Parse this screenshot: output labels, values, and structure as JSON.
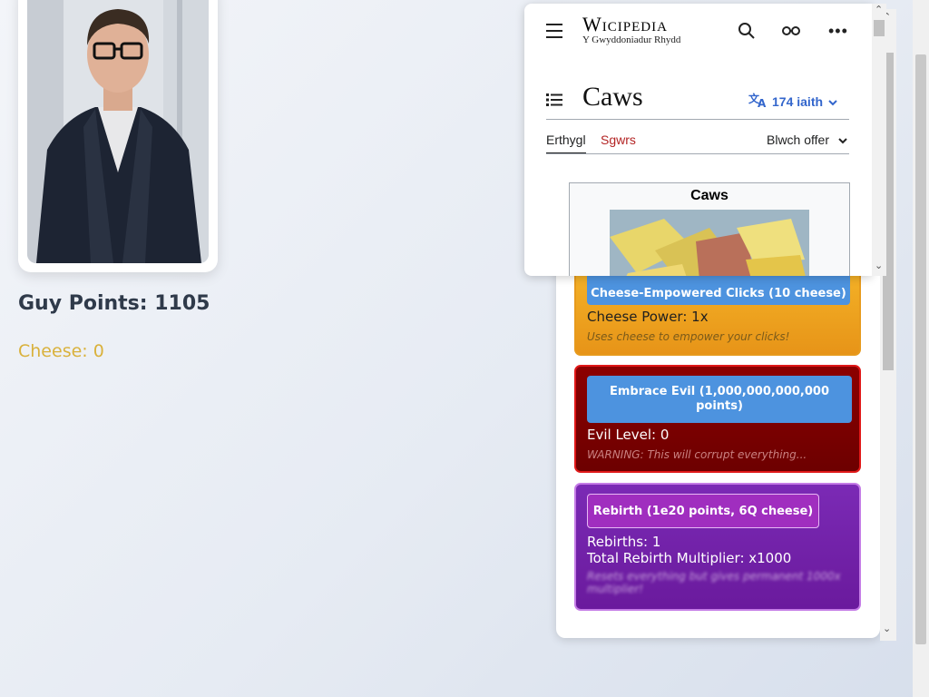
{
  "profile": {
    "photo_alt": "Profile photo of a man in glasses and dark jacket"
  },
  "stats": {
    "guy_points": "Guy Points: 1105",
    "cheese": "Cheese: 0"
  },
  "shop": {
    "cheese_card": {
      "button_label": "Cheese-Empowered Clicks (10 cheese)",
      "status": "Cheese Power: 1x",
      "description": "Uses cheese to empower your clicks!"
    },
    "evil_card": {
      "button_label": "Embrace Evil (1,000,000,000,000 points)",
      "status": "Evil Level: 0",
      "description": "WARNING: This will corrupt everything..."
    },
    "rebirth_card": {
      "button_label": "Rebirth (1e20 points, 6Q cheese)",
      "status_rebirths": "Rebirths: 1",
      "status_multiplier": "Total Rebirth Multiplier: x1000",
      "description": "Resets everything but gives permanent 1000x multiplier!"
    }
  },
  "wiki": {
    "logo": "Wicipedia",
    "tagline": "Y Gwyddoniadur Rhydd",
    "article_title": "Caws",
    "languages": "174 iaith",
    "tabs": {
      "article": "Erthygl",
      "talk": "Sgwrs"
    },
    "tools": "Blwch offer",
    "infobox_title": "Caws"
  },
  "colors": {
    "cheese_card": "#f4b227",
    "evil_card": "#8c0000",
    "rebirth_card": "#7b2ab5",
    "button_blue": "#4d93df",
    "wiki_link": "#3366cc",
    "talk_red": "#b32424"
  }
}
